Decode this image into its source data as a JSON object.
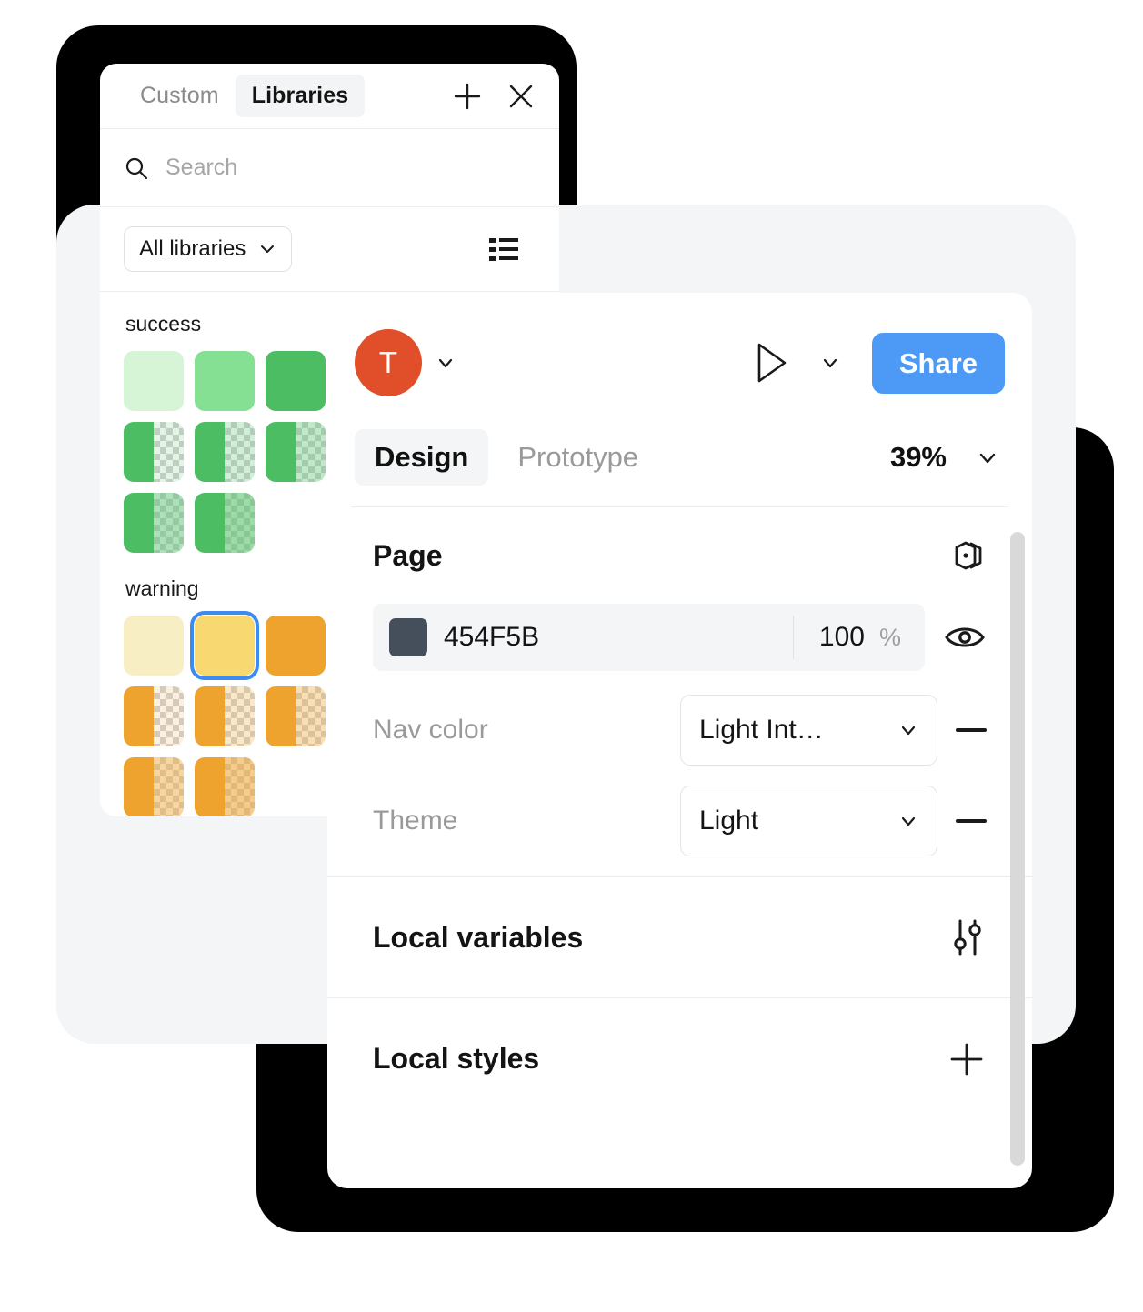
{
  "libraries_panel": {
    "tabs": [
      {
        "label": "Custom",
        "active": false
      },
      {
        "label": "Libraries",
        "active": true
      }
    ],
    "add_icon": "plus-icon",
    "close_icon": "close-icon",
    "search": {
      "placeholder": "Search",
      "value": "",
      "icon": "search-icon"
    },
    "filter": {
      "selected": "All libraries",
      "chevron": "chevron-down-icon",
      "view_icon": "list-view-icon"
    },
    "groups": [
      {
        "name": "success",
        "swatches": [
          {
            "type": "solid",
            "color": "#d6f5d6",
            "selected": false
          },
          {
            "type": "solid",
            "color": "#86e093",
            "selected": false
          },
          {
            "type": "solid",
            "color": "#4cbd63",
            "selected": false
          },
          {
            "type": "alpha",
            "color": "#4cbd63",
            "alpha": 0.15,
            "selected": false
          },
          {
            "type": "alpha",
            "color": "#4cbd63",
            "alpha": 0.25,
            "selected": false
          },
          {
            "type": "alpha",
            "color": "#4cbd63",
            "alpha": 0.35,
            "selected": false
          },
          {
            "type": "alpha",
            "color": "#4cbd63",
            "alpha": 0.45,
            "selected": false
          },
          {
            "type": "alpha",
            "color": "#4cbd63",
            "alpha": 0.55,
            "selected": false
          }
        ]
      },
      {
        "name": "warning",
        "swatches": [
          {
            "type": "solid",
            "color": "#f7eec4",
            "selected": false
          },
          {
            "type": "solid",
            "color": "#f8d870",
            "selected": true
          },
          {
            "type": "solid",
            "color": "#eda32e",
            "selected": false
          },
          {
            "type": "alpha",
            "color": "#eda32e",
            "alpha": 0.15,
            "selected": false
          },
          {
            "type": "alpha",
            "color": "#eda32e",
            "alpha": 0.25,
            "selected": false
          },
          {
            "type": "alpha",
            "color": "#eda32e",
            "alpha": 0.35,
            "selected": false
          },
          {
            "type": "alpha",
            "color": "#eda32e",
            "alpha": 0.45,
            "selected": false
          },
          {
            "type": "alpha",
            "color": "#eda32e",
            "alpha": 0.55,
            "selected": false
          }
        ]
      }
    ]
  },
  "design_panel": {
    "avatar": {
      "initial": "T",
      "color": "#e04e2a"
    },
    "avatar_chevron": "chevron-down-icon",
    "present_icon": "play-icon",
    "present_chevron": "chevron-down-icon",
    "share_label": "Share",
    "share_color": "#4c9af5",
    "tabs": [
      {
        "label": "Design",
        "active": true
      },
      {
        "label": "Prototype",
        "active": false
      }
    ],
    "zoom": "39%",
    "zoom_chevron": "chevron-down-icon",
    "page_section": {
      "title": "Page",
      "action_icon": "multi-page-icon",
      "fill": {
        "swatch_color": "#454f5b",
        "hex": "454F5B",
        "opacity": "100",
        "opacity_unit": "%",
        "visibility_icon": "eye-icon"
      },
      "properties": [
        {
          "label": "Nav color",
          "value": "Light Int…",
          "chevron": "chevron-down-icon",
          "remove_icon": "minus-icon"
        },
        {
          "label": "Theme",
          "value": "Light",
          "chevron": "chevron-down-icon",
          "remove_icon": "minus-icon"
        }
      ]
    },
    "local_variables": {
      "label": "Local variables",
      "action_icon": "sliders-icon"
    },
    "local_styles": {
      "label": "Local styles",
      "action_icon": "plus-icon"
    }
  }
}
